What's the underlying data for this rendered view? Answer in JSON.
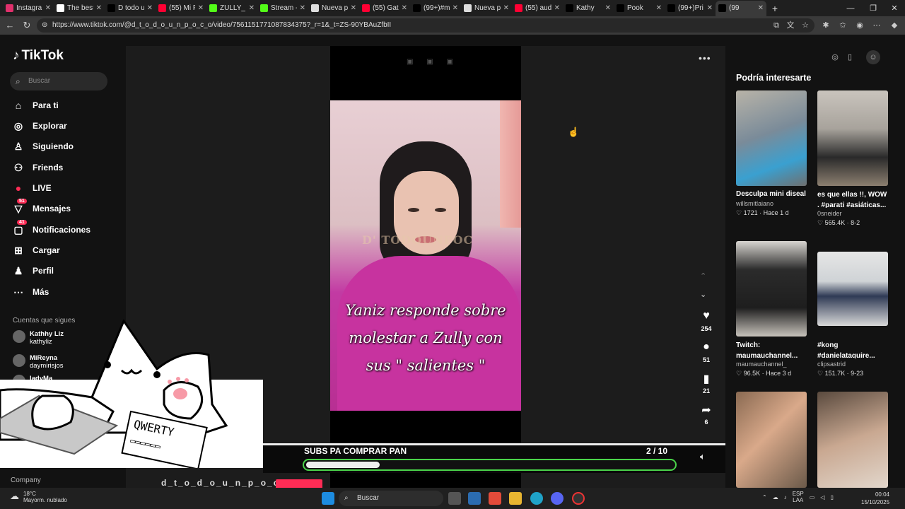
{
  "browser": {
    "tabs": [
      {
        "label": "Instagra",
        "color": "#e1306c"
      },
      {
        "label": "The best",
        "color": "#ffffff"
      },
      {
        "label": "D todo u",
        "color": "#000000"
      },
      {
        "label": "(55) Mi P",
        "color": "#ff0033"
      },
      {
        "label": "ZULLY_",
        "color": "#53fc18"
      },
      {
        "label": "Stream -",
        "color": "#53fc18"
      },
      {
        "label": "Nueva p",
        "color": "#dddddd"
      },
      {
        "label": "(55) Gat",
        "color": "#ff0033"
      },
      {
        "label": "(99+)#m",
        "color": "#000000"
      },
      {
        "label": "Nueva p",
        "color": "#dddddd"
      },
      {
        "label": "(55) aud",
        "color": "#ff0033"
      },
      {
        "label": "Kathy",
        "color": "#000000"
      },
      {
        "label": "Pook",
        "color": "#000000"
      },
      {
        "label": "(99+)Pri",
        "color": "#000000"
      },
      {
        "label": "(99",
        "color": "#000000"
      }
    ],
    "url": "https://www.tiktok.com/@d_t_o_d_o_u_n_p_o_c_o/video/7561151771087834375?_r=1&_t=ZS-90YBAuZfbII"
  },
  "tiktok": {
    "logo": "TikTok",
    "search_placeholder": "Buscar",
    "nav": [
      {
        "label": "Para ti",
        "icon": "home-icon"
      },
      {
        "label": "Explorar",
        "icon": "compass-icon"
      },
      {
        "label": "Siguiendo",
        "icon": "following-icon"
      },
      {
        "label": "Friends",
        "icon": "friends-icon"
      },
      {
        "label": "LIVE",
        "icon": "live-icon"
      },
      {
        "label": "Mensajes",
        "icon": "messages-icon",
        "badge": "51"
      },
      {
        "label": "Notificaciones",
        "icon": "notifications-icon",
        "badge": "41"
      },
      {
        "label": "Cargar",
        "icon": "upload-icon"
      },
      {
        "label": "Perfil",
        "icon": "profile-icon"
      },
      {
        "label": "Más",
        "icon": "more-icon"
      }
    ],
    "following_heading": "Cuentas que sigues",
    "following": [
      {
        "name": "Kathhy Liz",
        "handle": "kathyliz"
      },
      {
        "name": "MiReyna",
        "handle": "daymirisjos"
      },
      {
        "name": "ladyMa",
        "handle": ""
      }
    ],
    "company": "Company",
    "video": {
      "watermark": "D' TODOUNPOC",
      "caption": "Yaniz responde sobre molestar a Zully con sus \" salientes \""
    },
    "actions": {
      "likes": "254",
      "comments": "51",
      "saves": "21",
      "shares": "6"
    },
    "author_peek": "d_t_o_d_o_u_n_p_o_c_o",
    "suggestions_title": "Podría interesarte",
    "suggestions": [
      {
        "title": "Desculpa mini diseal",
        "author": "willsmitlaiano",
        "stats": "1721 · Hace 1 d"
      },
      {
        "title": "es que ellas !!, WOW . #parati #asiáticas...",
        "author": "0sneider",
        "stats": "565.4K · 8-2"
      },
      {
        "title": "Twitch: maumauchannel...",
        "author": "maumauchannel_",
        "stats": "96.5K · Hace 3 d"
      },
      {
        "title": "#kong #danielataquire...",
        "author": "clipsastrid",
        "stats": "151.7K · 9-23"
      }
    ]
  },
  "overlay": {
    "goal_label": "SUBS PA COMPRAR PAN",
    "goal_count": "2  / 10",
    "goal_progress": 0.2,
    "keyboard_keys": "QWERTY"
  },
  "taskbar": {
    "temperature": "18°C",
    "weather": "Mayorm. nublado",
    "search": "Buscar",
    "lang1": "ESP",
    "lang2": "LAA",
    "time": "00:04",
    "date": "15/10/2025"
  }
}
